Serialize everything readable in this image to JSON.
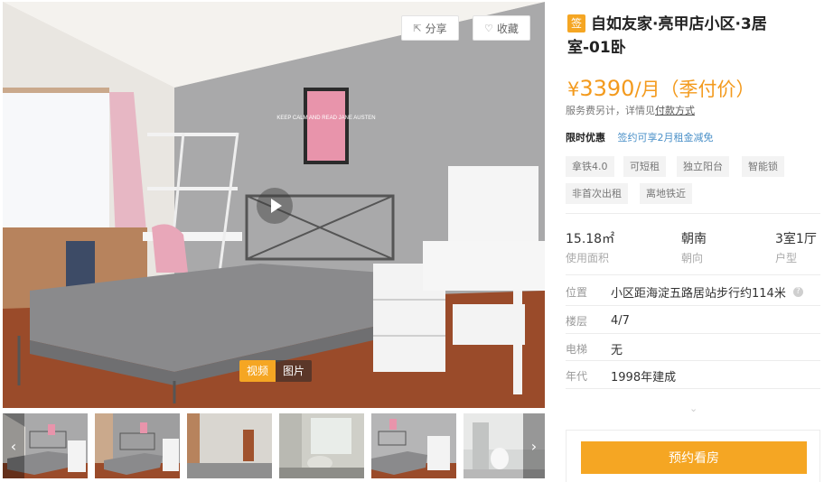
{
  "actions": {
    "share": "分享",
    "favorite": "收藏"
  },
  "media_tabs": [
    "视频",
    "图片"
  ],
  "listing": {
    "badge": "签",
    "title": "自如友家·亮甲店小区·3居室-01卧",
    "price_symbol": "¥",
    "price_value": "3390",
    "price_unit": "/月（季付价）",
    "fee_note_prefix": "服务费另计，详情见",
    "fee_note_link": "付款方式",
    "promo_label": "限时优惠",
    "promo_text": "签约可享2月租金减免",
    "tags": [
      "拿铁4.0",
      "可短租",
      "独立阳台",
      "智能锁",
      "非首次出租",
      "离地铁近"
    ],
    "stats": [
      {
        "value": "15.18㎡",
        "label": "使用面积"
      },
      {
        "value": "朝南",
        "label": "朝向"
      },
      {
        "value": "3室1厅",
        "label": "户型"
      }
    ],
    "details": [
      {
        "label": "位置",
        "value": "小区距海淀五路居站步行约114米"
      },
      {
        "label": "楼层",
        "value": "4/7"
      },
      {
        "label": "电梯",
        "value": "无"
      },
      {
        "label": "年代",
        "value": "1998年建成"
      }
    ],
    "expand_icon": "⌄",
    "book_button": "预约看房"
  },
  "colors": {
    "accent": "#f5a623",
    "price": "#f39a1d",
    "link": "#4a90c8"
  },
  "icons": {
    "share": "share-icon",
    "favorite": "heart-icon",
    "play": "play-icon",
    "prev": "chevron-left-icon",
    "next": "chevron-right-icon",
    "help": "help-icon"
  },
  "poster_text": "KEEP CALM AND READ JANE AUSTEN"
}
